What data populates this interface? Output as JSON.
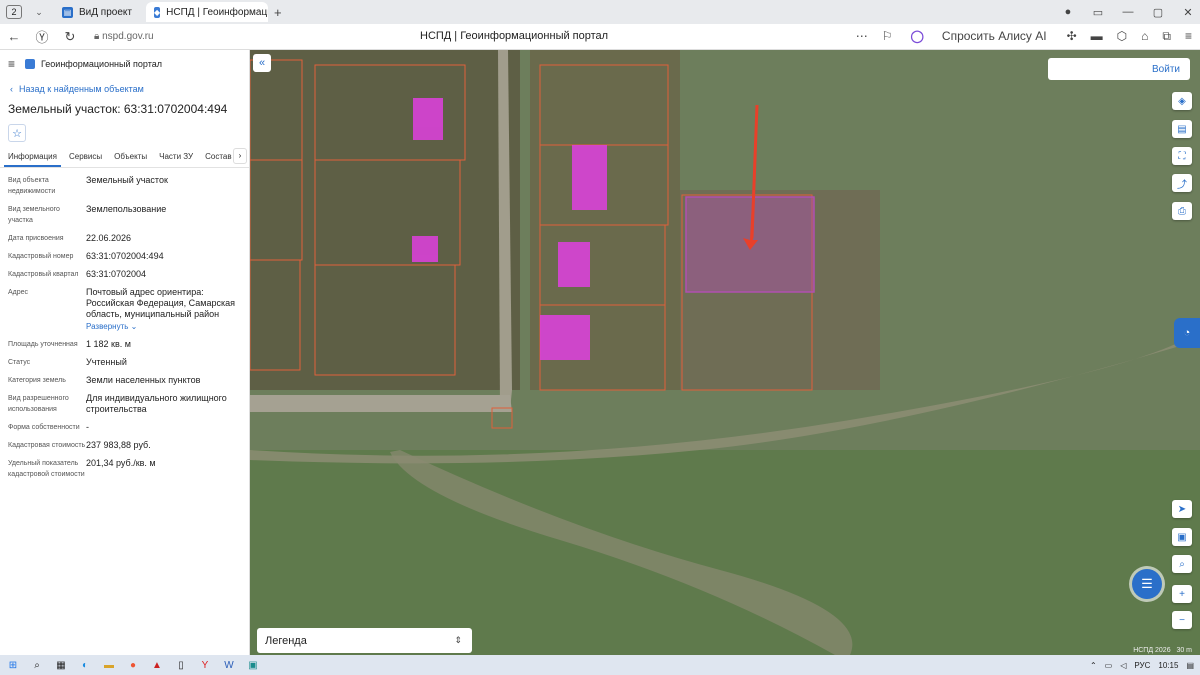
{
  "browser": {
    "tab_count": "2",
    "tabs": [
      {
        "label": "ВиД проект",
        "active": false
      },
      {
        "label": "НСПД | Геоинформаци",
        "active": true
      }
    ],
    "url": "nspd.gov.ru",
    "page_title": "НСПД | Геоинформационный портал",
    "alisa_label": "Спросить Алису AI",
    "colors": {
      "tabbar": "#e8eaed",
      "accent": "#2a6fc9"
    }
  },
  "sidebar": {
    "portal_name": "Геоинформационный портал",
    "back_link": "Назад к найденным объектам",
    "title": "Земельный участок: 63:31:0702004:494",
    "tabs": [
      "Информация",
      "Сервисы",
      "Объекты",
      "Части ЗУ",
      "Состав"
    ],
    "properties": [
      {
        "key": "Вид объекта недвижимости",
        "value": "Земельный участок"
      },
      {
        "key": "Вид земельного участка",
        "value": "Землепользование"
      },
      {
        "key": "Дата присвоения",
        "value": "22.06.2026"
      },
      {
        "key": "Кадастровый номер",
        "value": "63:31:0702004:494"
      },
      {
        "key": "Кадастровый квартал",
        "value": "63:31:0702004"
      },
      {
        "key": "Адрес",
        "value": "Почтовый адрес ориентира: Российская Федерация, Самарская область, муниципальный район"
      },
      {
        "key": "Площадь уточненная",
        "value": "1 182 кв. м"
      },
      {
        "key": "Статус",
        "value": "Учтенный"
      },
      {
        "key": "Категория земель",
        "value": "Земли населенных пунктов"
      },
      {
        "key": "Вид разрешенного использования",
        "value": "Для индивидуального жилищного строительства"
      },
      {
        "key": "Форма собственности",
        "value": "-"
      },
      {
        "key": "Кадастровая стоимость",
        "value": "237 983,88 руб."
      },
      {
        "key": "Удельный показатель кадастровой стоимости",
        "value": "201,34 руб./кв. м"
      }
    ],
    "expand_label": "Развернуть"
  },
  "map": {
    "login": "Войти",
    "legend": "Легенда",
    "attribution": "НСПД 2026",
    "scale": "30 m",
    "colors": {
      "parcel_outline": "#e0603a",
      "building": "#e040e0",
      "selected": "#b050b0",
      "arrow": "#e8402a"
    }
  },
  "taskbar": {
    "lang": "РУС",
    "time": "10:15"
  }
}
